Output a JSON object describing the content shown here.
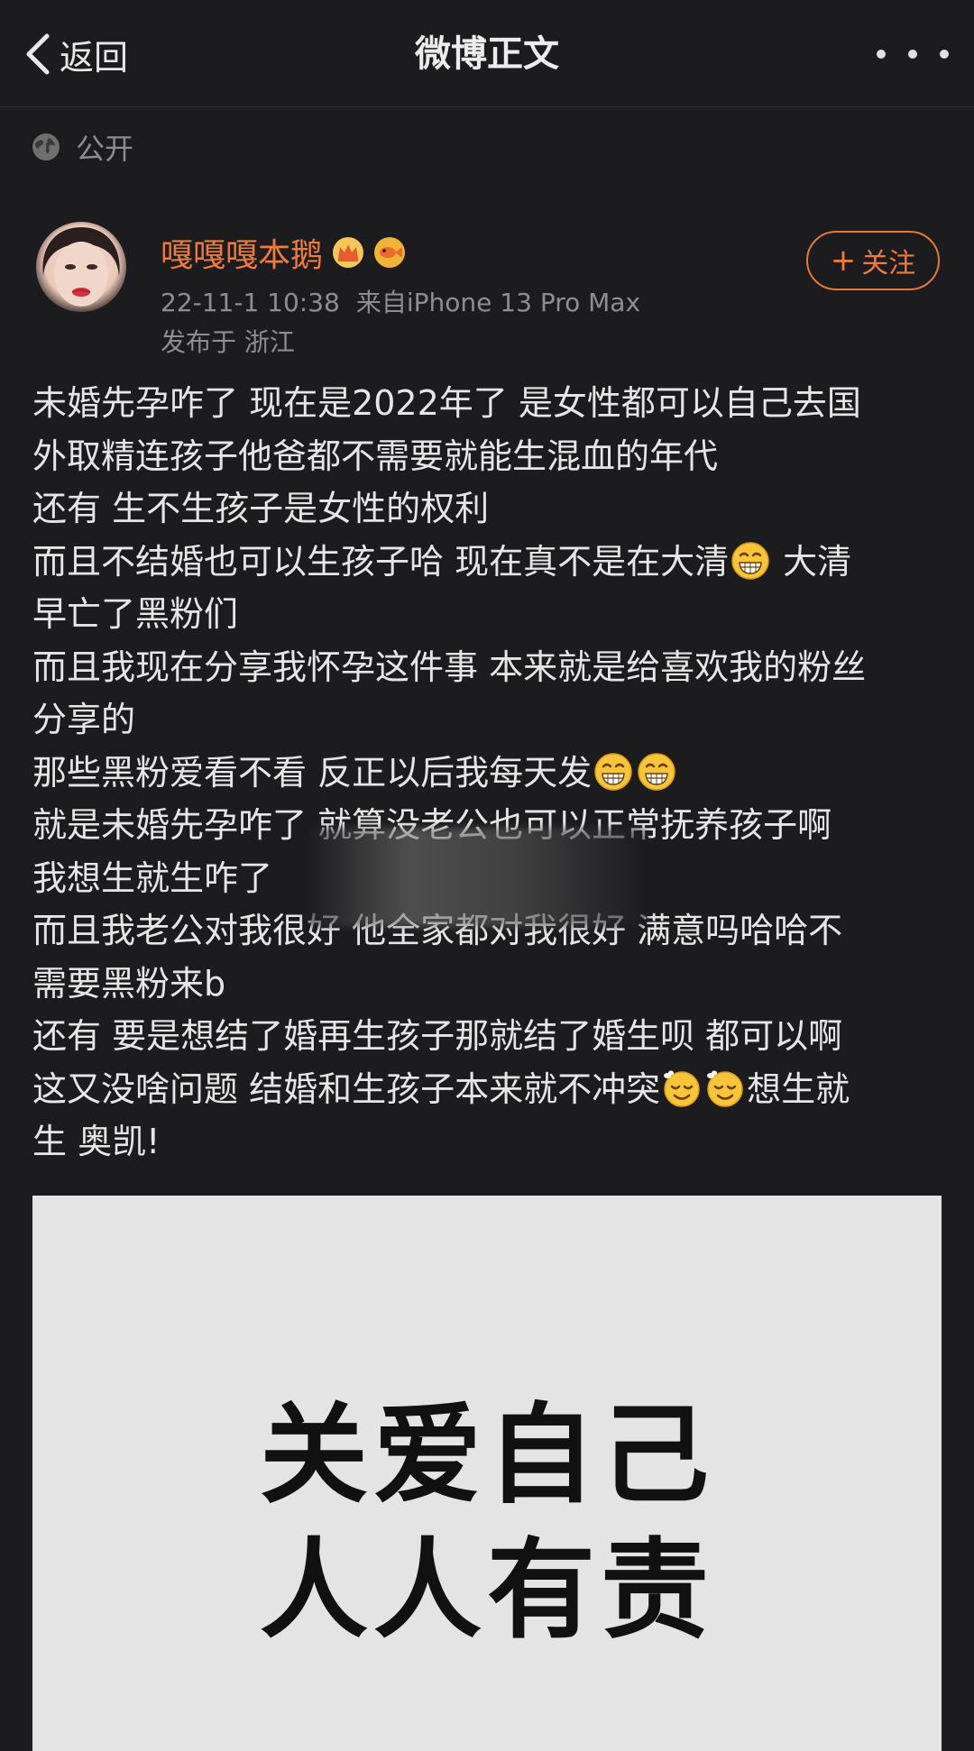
{
  "navbar": {
    "back_label": "返回",
    "title": "微博正文",
    "more_icon": "more-dots-icon"
  },
  "visibility": {
    "icon": "globe-icon",
    "label": "公开"
  },
  "author": {
    "name": "嘎嘎嘎本鹅",
    "badges": [
      "crown-badge-icon",
      "fish-badge-icon"
    ],
    "post_time": "22-11-1 10:38",
    "source": "来自iPhone 13 Pro Max",
    "location": "发布于 浙江"
  },
  "follow_button": {
    "label": "关注"
  },
  "post": {
    "lines": [
      {
        "text": "未婚先孕咋了 现在是2022年了 是女性都可以自己去国"
      },
      {
        "text": "外取精连孩子他爸都不需要就能生混血的年代"
      },
      {
        "text": "还有 生不生孩子是女性的权利"
      },
      {
        "text": "而且不结婚也可以生孩子哈 现在真不是在大清",
        "emoji_after": [
          "grin-emoji"
        ],
        "tail": " 大清"
      },
      {
        "text": "早亡了黑粉们"
      },
      {
        "text": "而且我现在分享我怀孕这件事 本来就是给喜欢我的粉丝"
      },
      {
        "text": "分享的"
      },
      {
        "text": "那些黑粉爱看不看 反正以后我每天发",
        "emoji_after": [
          "grin-emoji",
          "grin-emoji"
        ]
      },
      {
        "text": "就是未婚先孕咋了 就算没老公也可以正常抚养孩子啊"
      },
      {
        "text": "我想生就生咋了"
      },
      {
        "text": "而且我老公对我很好 他全家都对我很好 满意吗哈哈不"
      },
      {
        "text": "需要黑粉来b"
      },
      {
        "text": "还有 要是想结了婚再生孩子那就结了婚生呗 都可以啊"
      },
      {
        "text": "这又没啥问题 结婚和生孩子本来就不冲突",
        "emoji_after": [
          "relieved-emoji",
          "relieved-emoji"
        ],
        "tail": "想生就"
      },
      {
        "text": "生 奥凯!"
      }
    ]
  },
  "image": {
    "line1": "关爱自己",
    "line2": "人人有责",
    "background": "#e4e4e4"
  },
  "colors": {
    "accent": "#ef7a3d",
    "background": "#1c1c1e",
    "text": "#e6e6e6",
    "muted": "#8e8e8e"
  }
}
